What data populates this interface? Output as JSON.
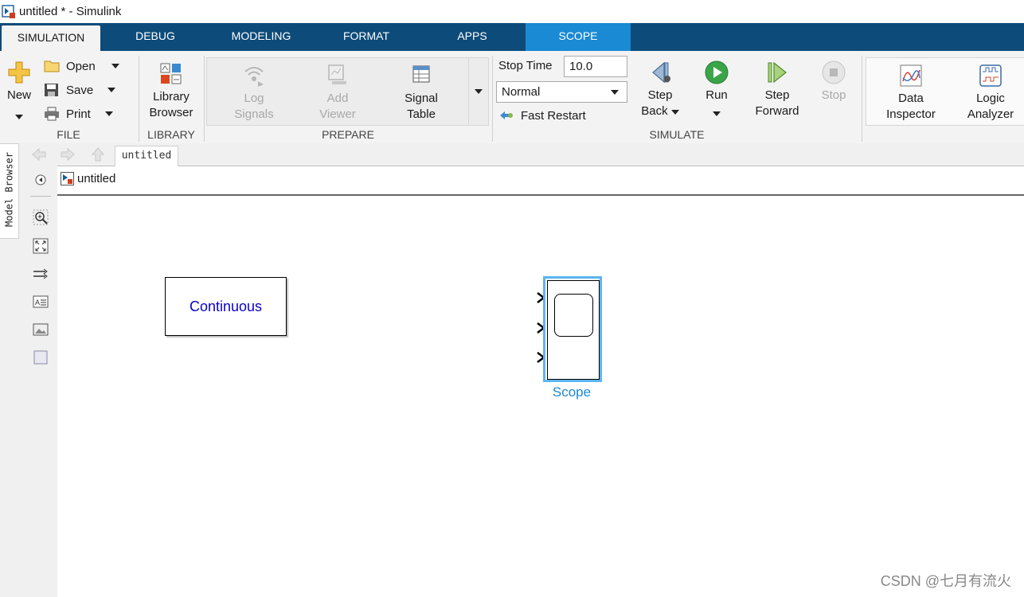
{
  "window": {
    "title": "untitled * - Simulink"
  },
  "tabs": [
    {
      "label": "SIMULATION",
      "state": "active"
    },
    {
      "label": "DEBUG"
    },
    {
      "label": "MODELING"
    },
    {
      "label": "FORMAT"
    },
    {
      "label": "APPS"
    },
    {
      "label": "SCOPE",
      "state": "contextual"
    }
  ],
  "file": {
    "new_label": "New",
    "open_label": "Open",
    "save_label": "Save",
    "print_label": "Print",
    "group": "FILE"
  },
  "library": {
    "browser_line1": "Library",
    "browser_line2": "Browser",
    "group": "LIBRARY"
  },
  "prepare": {
    "log_line1": "Log",
    "log_line2": "Signals",
    "viewer_line1": "Add",
    "viewer_line2": "Viewer",
    "table_line1": "Signal",
    "table_line2": "Table",
    "group": "PREPARE"
  },
  "simulate": {
    "stop_time_label": "Stop Time",
    "stop_time_value": "10.0",
    "mode_value": "Normal",
    "fast_restart_label": "Fast Restart",
    "step_back_line1": "Step",
    "step_back_line2": "Back",
    "run_label": "Run",
    "step_fwd_line1": "Step",
    "step_fwd_line2": "Forward",
    "stop_label": "Stop",
    "group": "SIMULATE"
  },
  "review": {
    "data_line1": "Data",
    "data_line2": "Inspector",
    "logic_line1": "Logic",
    "logic_line2": "Analyzer"
  },
  "model_browser": {
    "label": "Model Browser"
  },
  "editor": {
    "doc_tab": "untitled",
    "breadcrumb": "untitled"
  },
  "canvas": {
    "blocks": [
      {
        "label": "Continuous"
      },
      {
        "label": "Scope"
      }
    ]
  },
  "watermark": "CSDN @七月有流火",
  "colors": {
    "tabstrip": "#0d4b7a",
    "contextual_tab": "#1a8ad4",
    "selection": "#5db4ef",
    "run_green": "#3aa548"
  }
}
